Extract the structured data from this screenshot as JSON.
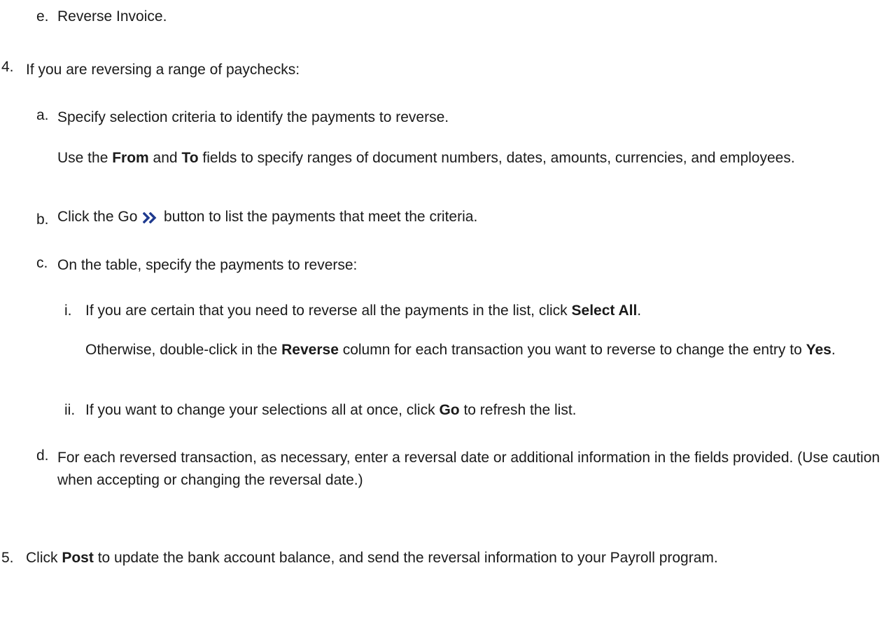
{
  "steps": {
    "e": {
      "marker": "e.",
      "text": "Reverse Invoice."
    },
    "s4": {
      "marker": "4.",
      "text": "If you are reversing a range of paychecks:"
    },
    "a": {
      "marker": "a.",
      "text": "Specify selection criteria to identify the payments to reverse.",
      "note": {
        "pre": "Use the ",
        "from": "From",
        "mid": " and ",
        "to": "To",
        "post": " fields to specify ranges of document numbers, dates, amounts, currencies, and employees."
      }
    },
    "b": {
      "marker": "b.",
      "pre": "Click the Go ",
      "icon": "double-chevron-right-icon",
      "post": " button to list the payments that meet the criteria."
    },
    "c": {
      "marker": "c.",
      "text": "On the table, specify the payments to reverse:"
    },
    "i": {
      "marker": "i.",
      "pre": "If you are certain that you need to reverse all the payments in the list, click ",
      "bold": "Select All",
      "post": ".",
      "note": {
        "pre": "Otherwise, double-click in the ",
        "reverse": "Reverse",
        "mid": " column for each transaction you want to reverse to change the entry to ",
        "yes": "Yes",
        "post": "."
      }
    },
    "ii": {
      "marker": "ii.",
      "pre": "If you want to change your selections all at once, click ",
      "bold": "Go",
      "post": " to refresh the list."
    },
    "d": {
      "marker": "d.",
      "text": "For each reversed transaction, as necessary, enter a reversal date or additional information in the fields provided. (Use caution when accepting or changing the reversal date.)"
    },
    "s5": {
      "marker": "5.",
      "pre": "Click ",
      "bold": "Post",
      "post": " to update the bank account balance, and send the reversal information to your Payroll program."
    }
  },
  "colors": {
    "text": "#1a1a1a",
    "icon": "#1f3a8f"
  }
}
